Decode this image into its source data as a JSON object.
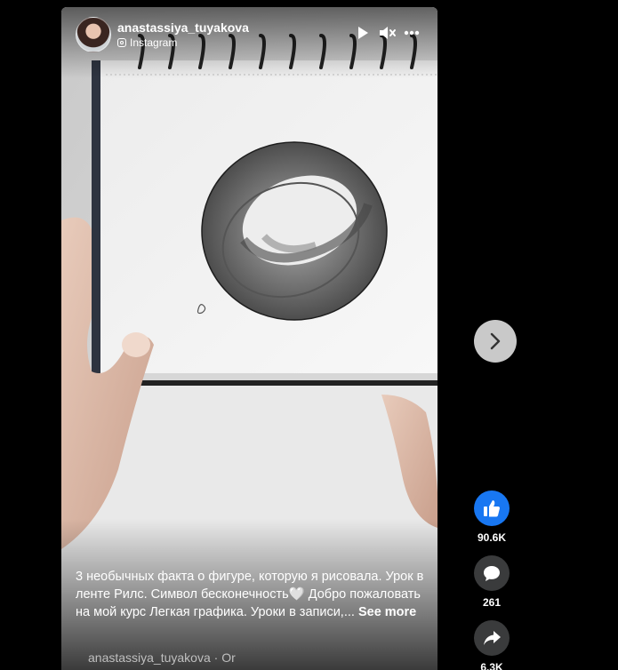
{
  "post": {
    "author": "anastassiya_tuyakova",
    "source": "Instagram",
    "caption": "3 необычных факта о фигуре, которую я рисовала. Урок в ленте Рилс. Символ бесконечность🤍 Добро пожаловать на мой курс Легкая графика. Уроки в записи,... ",
    "see_more": "See more",
    "footer_text": "anastassiya_tuyakova · Or"
  },
  "controls": {
    "play_icon": "play-icon",
    "mute_icon": "speaker-muted-icon",
    "more_icon": "more-dots-icon"
  },
  "actions": {
    "likes": "90.6K",
    "comments": "261",
    "shares": "6.3K"
  },
  "colors": {
    "like_blue": "#1877f2",
    "action_gray": "#3a3b3c",
    "next_button": "#c9c9c9",
    "background": "#000000"
  }
}
